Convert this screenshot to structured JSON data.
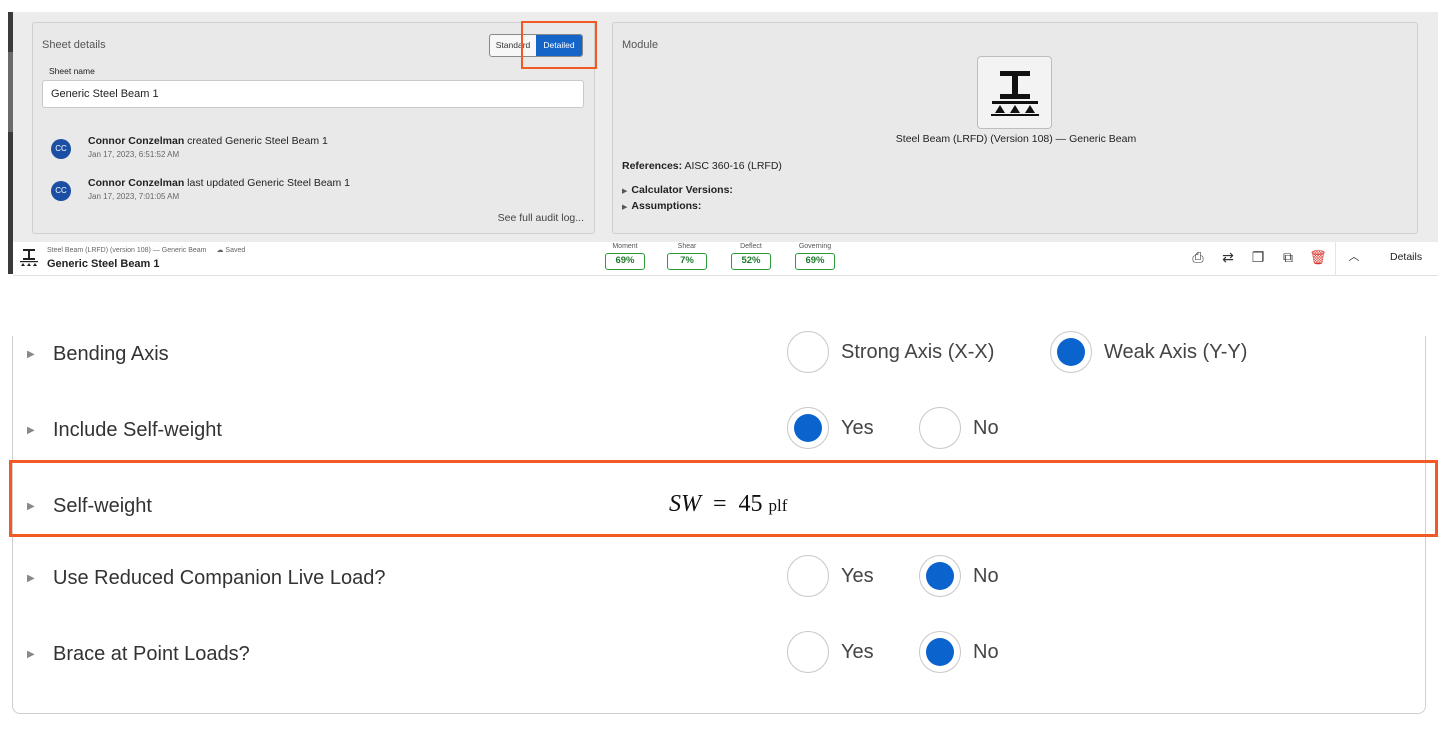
{
  "sheet_details": {
    "title": "Sheet details",
    "toggle": {
      "standard": "Standard",
      "detailed": "Detailed"
    },
    "sheet_name_label": "Sheet name",
    "sheet_name_value": "Generic Steel Beam 1",
    "audit": [
      {
        "initials": "CC",
        "user": "Connor Conzelman",
        "action": " created Generic Steel Beam 1",
        "time": "Jan 17, 2023, 6:51:52 AM"
      },
      {
        "initials": "CC",
        "user": "Connor Conzelman",
        "action": " last updated Generic Steel Beam 1",
        "time": "Jan 17, 2023, 7:01:05 AM"
      }
    ],
    "audit_link": "See full audit log..."
  },
  "module": {
    "title": "Module",
    "name": "Steel Beam (LRFD) (Version 108) — Generic Beam",
    "references_label": "References:",
    "references_value": " AISC 360-16 (LRFD)",
    "calculator_versions": "Calculator Versions:",
    "assumptions": "Assumptions:"
  },
  "status_bar": {
    "subtitle": "Steel Beam (LRFD) (version 108) — Generic Beam",
    "saved": "Saved",
    "title": "Generic Steel Beam 1",
    "metrics": [
      {
        "label": "Moment",
        "value": "69%"
      },
      {
        "label": "Shear",
        "value": "7%"
      },
      {
        "label": "Deflect",
        "value": "52%"
      },
      {
        "label": "Governing",
        "value": "69%"
      }
    ],
    "details": "Details",
    "status_color": "#2a9d3a"
  },
  "form": {
    "bending_axis": {
      "label": "Bending Axis",
      "options": [
        "Strong Axis (X-X)",
        "Weak Axis (Y-Y)"
      ],
      "selected": "Weak Axis (Y-Y)"
    },
    "include_self_weight": {
      "label": "Include Self-weight",
      "options": [
        "Yes",
        "No"
      ],
      "selected": "Yes"
    },
    "self_weight": {
      "label": "Self-weight",
      "variable": "SW",
      "equals": "=",
      "value": "45",
      "unit": "plf"
    },
    "reduced_live_load": {
      "label": "Use Reduced Companion Live Load?",
      "options": [
        "Yes",
        "No"
      ],
      "selected": "No"
    },
    "brace_point_loads": {
      "label": "Brace at Point Loads?",
      "options": [
        "Yes",
        "No"
      ],
      "selected": "No"
    }
  },
  "colors": {
    "accent": "#0b63ce",
    "highlight": "#f15a24",
    "delete": "#d9342b"
  }
}
